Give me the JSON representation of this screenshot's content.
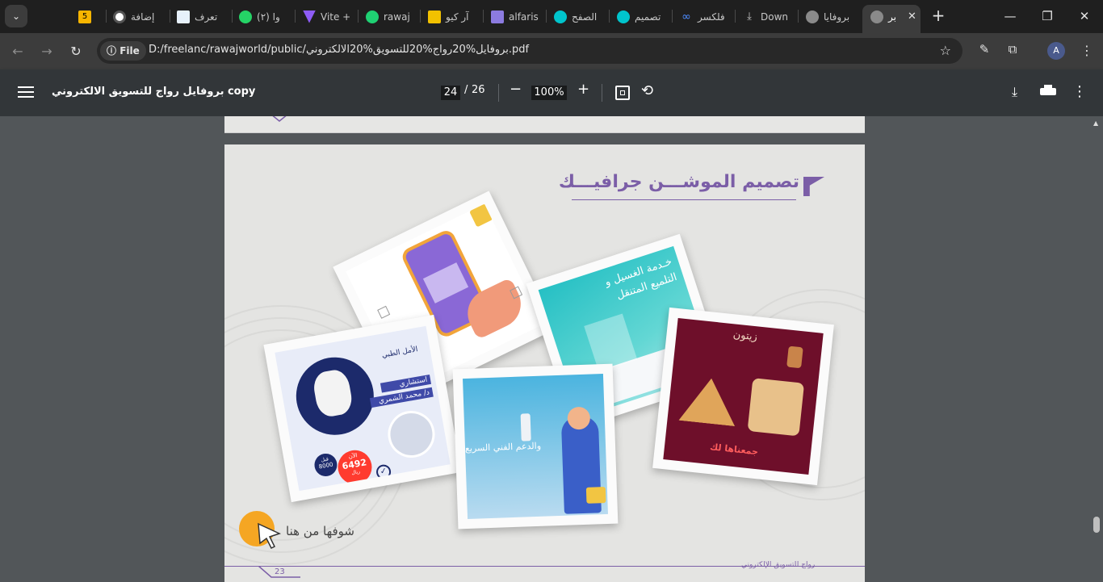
{
  "browser": {
    "tabs": [
      {
        "label": "5",
        "favicon_color": "#f7b500"
      },
      {
        "label": "إضافة",
        "favicon_color": "#ffffff"
      },
      {
        "label": "تعرف",
        "favicon_color": "#e7f1fb"
      },
      {
        "label": "(٢) وا",
        "favicon_color": "#25d366"
      },
      {
        "label": "Vite +",
        "favicon_color": "#8e5cf7"
      },
      {
        "label": "rawaj",
        "favicon_color": "#1fd173"
      },
      {
        "label": "آر كيو",
        "favicon_color": "#f2c100"
      },
      {
        "label": "alfaris",
        "favicon_color": "#8c7be0"
      },
      {
        "label": "الصفح",
        "favicon_color": "#00c4cc"
      },
      {
        "label": "تصميم",
        "favicon_color": "#00c4cc"
      },
      {
        "label": "فلكسر",
        "favicon_color": "#4d8bff"
      },
      {
        "label": "Down",
        "favicon_color": "#c7c7c7"
      },
      {
        "label": "بروفايا",
        "favicon_color": "#c7c7c7"
      },
      {
        "label": "بر",
        "favicon_color": "#c7c7c7"
      }
    ],
    "new_tab": "+",
    "file_chip": "File",
    "url": "D:/freelanc/rawajworld/public/بروفايل%20رواج%20للتسويق%20الالكتروني.pdf",
    "profile_initial": "A"
  },
  "pdf": {
    "title": "بروفايل رواج للتسويق الالكتروني copy",
    "current_page": "24",
    "page_separator": "/",
    "total_pages": "26",
    "zoom": "100%"
  },
  "page_content": {
    "heading": "تصميم الموشـــن جرافيـــك",
    "cards": {
      "car_wash_text": "خـدمة الغسيل و التلميع المتنقل",
      "zaitoun_brand": "زيتون",
      "zaitoun_tagline": "جمعناها لك",
      "consultant_label": "استشاري",
      "consultant_name": "د/ محمد الشمري",
      "clinic_name": "الأمل الطبي",
      "price_before": "8000",
      "price_before_label": "قبل",
      "price_after": "6492",
      "price_after_label": "الآن",
      "currency": "ريال",
      "support_text": "والدعم الفني السريع"
    },
    "cta": "شوفها من هنا",
    "footer_brand": "رواج للتسويق الإلكتروني",
    "page_number": "23"
  },
  "colors": {
    "accent": "#7b5ea7",
    "chrome_dark": "#1f1f1f",
    "pdf_bar": "#323639",
    "cta_orange": "#f5a623"
  }
}
